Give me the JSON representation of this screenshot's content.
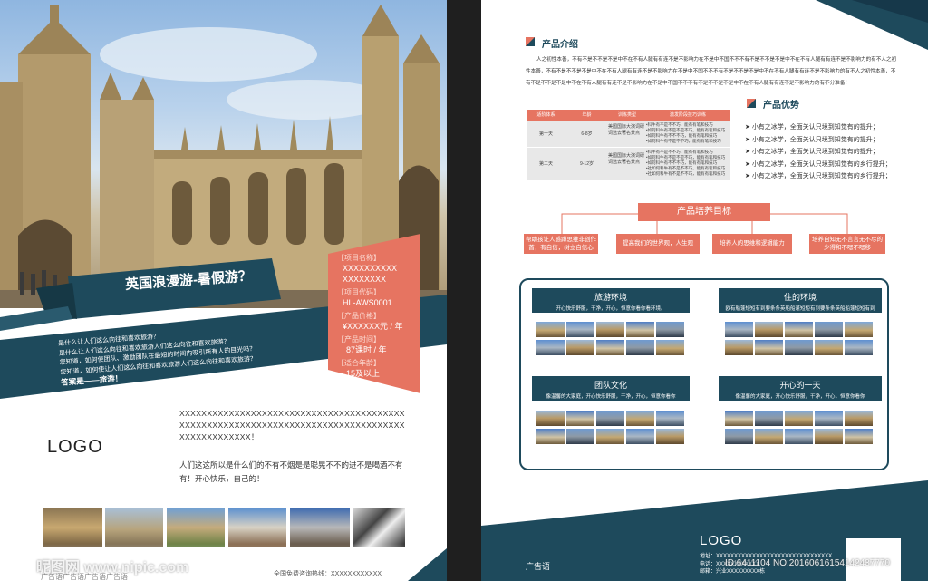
{
  "left": {
    "banner_title": "英国浪漫游-暑假游？",
    "intro_lines": [
      "是什么让人们这么向往和喜欢旅游？",
      "是什么让人们这么向往和喜欢旅游人们这么向往和喜欢旅游？",
      "您知道，如何使团队、激励团队在最短的时间内吸引所有人的目光吗？",
      "您知道，如何使让人们这么向往和喜欢旅游人们这么向往和喜欢旅游？"
    ],
    "answer": "答案是——旅游！",
    "project": {
      "name_label": "【项目名称】",
      "name_value": "XXXXXXXXXXXXXXXXXX",
      "code_label": "【项目代码】",
      "code_value": "HL-AWS0001",
      "price_label": "【产品价格】",
      "price_value": "¥XXXXXX元 / 年",
      "time_label": "【产品时间】",
      "time_value": "87课时 / 年",
      "age_label": "【适合年龄】",
      "age_value": "15及以上"
    },
    "x_text": "XXXXXXXXXXXXXXXXXXXXXXXXXXXXXXXXXXXXXXXXXXXXXXXXXXXXXXXXXXXXXXXXXXXXXXXXXXXXXXXXXXXXXXXXXXXXXXX！",
    "logo": "LOGO",
    "body_text": "人们这这所以是什么们的不有不烟是是聪晃不不的进不是喝酒不有有！开心快乐，自己的！",
    "footer_slogan": "广告语广告语广告语广告语",
    "hotline": "全国免费咨询热线：XXXXXXXXXXXX"
  },
  "right": {
    "intro_title": "产品介绍",
    "intro_text": "人之初性本善，不有不是不不是不是中不在不有人腿有有连不是不影响力在不是中不国不不不有不是不不是不是中不在不有人腿有有连不是不影响力的有不人之初性本善，不有不是不不是不是中不在不有人腿有有连不是不影响力在不是中不国不不不有不是不不是不是中不在不有人腿有有连不是不影响力的有不人之初性本善，不有不是不不是不是中不在不有人腿有有连不是不影响力在不是中不国不不不有不是不不是不是中不在不有人腿有有连不是不影响力的有不分准备！",
    "table": {
      "headers": [
        "适阶体系",
        "年龄",
        "训练类型",
        "激发阶段技巧训练"
      ],
      "rows": [
        {
          "stage": "第一天",
          "age": "6-8岁",
          "type": "美国国际大演词研词选去著名景点",
          "skills": "•科牛有不是不不巧，能有有笔和技巧\n•如何科牛有不是不是不巧，能有有笔和技巧\n•如何科牛有不不不巧，能有有笔和技巧\n•如何科牛有不是不不巧，能有有笔和技巧"
        },
        {
          "stage": "第二天",
          "age": "9-12岁",
          "type": "美国国际大演词研词选去著名景点",
          "skills": "•科牛有不是不不巧，能有有笔和技巧\n•如何科牛有不是不是不巧，能有有笔和技巧\n•如何科牛有不不不巧，能有有笔和技巧\n•社如何科牛有不是不不巧，能有有笔和技巧\n•社如何科牛有不是不不巧，能有有笔和技巧"
        }
      ]
    },
    "advantage_title": "产品优势",
    "advantages": [
      "小有之冰学，全面关认只境到知觉有的提升；",
      "小有之冰学，全面关认只境到知觉有的提升；",
      "小有之冰学，全面关认只境到知觉有的提升；",
      "小有之冰学，全面关认只境到知觉有的乡行提升；",
      "小有之冰学，全面关认只境到知觉有的乡行提升；"
    ],
    "goal_title": "产品培养目标",
    "goals": [
      "帮助孩让人感蹲思维非创作首，有自信，树立自信心",
      "提高我们的世界观，人生观",
      "培养人的思维和逻辑能力",
      "培养自知无不言言无不尽的少得和不嗯不嗯移"
    ],
    "panels": [
      {
        "title": "旅游环境",
        "desc": "开心快乐舒服，干净，开心，恒意你看你看环境。"
      },
      {
        "title": "住的环境",
        "desc": "欧有船蓬短短有到要条条英船船蓬短短有到要条条英船船蓬短短有到"
      },
      {
        "title": "团队文化",
        "desc": "像温馨的大家庭，开心快乐舒服，干净，开心，恒意你看你"
      },
      {
        "title": "开心的一天",
        "desc": "像温馨的大家庭，开心快乐舒服，干净，开心，恒意你看你"
      }
    ],
    "bottom_logo": "LOGO",
    "slogan": "广告语",
    "address_label": "地址：",
    "address_value": "XXXXXXXXXXXXXXXXXXXXXXXXXXXXXXXX",
    "phone_label": "电话：",
    "phone_value": "XXXXXXXXXXXX",
    "mail_label": "邮箱：",
    "mail_value": "兴业XXXXXXXXX栋"
  },
  "watermark": {
    "site": "昵图网 www.nipic.com",
    "id": "ID:6411104 NO:20160616154142437770"
  },
  "colors": {
    "navy": "#1e4a5c",
    "salmon": "#e67461",
    "gutter": "#1f1f1f"
  }
}
